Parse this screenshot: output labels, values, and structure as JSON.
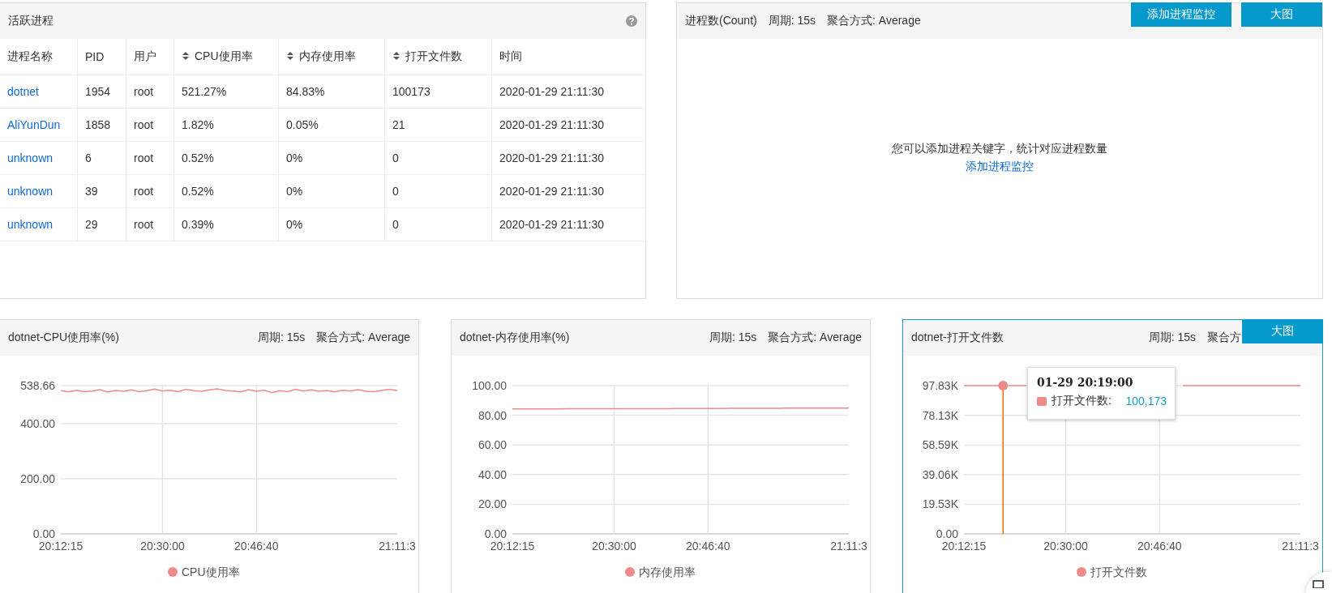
{
  "process_panel": {
    "title": "活跃进程",
    "columns": [
      {
        "label": "进程名称",
        "sortable": false
      },
      {
        "label": "PID",
        "sortable": false
      },
      {
        "label": "用户",
        "sortable": false
      },
      {
        "label": "CPU使用率",
        "sortable": true
      },
      {
        "label": "内存使用率",
        "sortable": true
      },
      {
        "label": "打开文件数",
        "sortable": true
      },
      {
        "label": "时间",
        "sortable": false
      }
    ],
    "rows": [
      [
        "dotnet",
        "1954",
        "root",
        "521.27%",
        "84.83%",
        "100173",
        "2020-01-29 21:11:30"
      ],
      [
        "AliYunDun",
        "1858",
        "root",
        "1.82%",
        "0.05%",
        "21",
        "2020-01-29 21:11:30"
      ],
      [
        "unknown",
        "6",
        "root",
        "0.52%",
        "0%",
        "0",
        "2020-01-29 21:11:30"
      ],
      [
        "unknown",
        "39",
        "root",
        "0.52%",
        "0%",
        "0",
        "2020-01-29 21:11:30"
      ],
      [
        "unknown",
        "29",
        "root",
        "0.39%",
        "0%",
        "0",
        "2020-01-29 21:11:30"
      ]
    ]
  },
  "count_panel": {
    "title": "进程数(Count)",
    "period": "周期: 15s",
    "aggregation": "聚合方式: Average",
    "buttons": [
      "添加进程监控",
      "大图"
    ],
    "empty_message": "您可以添加进程关键字，统计对应进程数量",
    "empty_link": "添加进程监控"
  },
  "chart_panels": [
    {
      "title": "dotnet-CPU使用率(%)",
      "period": "周期: 15s",
      "aggregation": "聚合方式: Average",
      "selected": false,
      "chart_data": {
        "type": "line",
        "grid": true,
        "categories": [
          "20:12:15",
          null,
          null,
          null,
          null,
          null,
          null,
          null,
          null,
          null,
          null,
          null,
          null,
          "20:30:00",
          null,
          null,
          null,
          null,
          null,
          null,
          null,
          null,
          null,
          null,
          null,
          "20:46:40",
          null,
          null,
          null,
          null,
          null,
          null,
          null,
          null,
          null,
          null,
          null,
          null,
          null,
          null,
          null,
          null,
          null,
          "21:11:3"
        ],
        "series": [
          {
            "name": "CPU使用率",
            "color": "#ef8a8a",
            "values": [
              520,
              516,
              522,
              517,
              519,
              524,
              515,
              521,
              518,
              523,
              517,
              520,
              526,
              519,
              522,
              517,
              525,
              520,
              518,
              523,
              527,
              521,
              519,
              516,
              524,
              518,
              522,
              513,
              520,
              517,
              525,
              519,
              523,
              518,
              521,
              516,
              522,
              519,
              524,
              518,
              517,
              521,
              525,
              520
            ]
          }
        ],
        "ylim": [
          0,
          538.66
        ],
        "yticks": [
          {
            "value": 0,
            "label": "0.00"
          },
          {
            "value": 200,
            "label": "200.00"
          },
          {
            "value": 400,
            "label": "400.00"
          },
          {
            "value": 538.66,
            "label": "538.66"
          }
        ]
      }
    },
    {
      "title": "dotnet-内存使用率(%)",
      "period": "周期: 15s",
      "aggregation": "聚合方式: Average",
      "selected": false,
      "chart_data": {
        "type": "line",
        "grid": true,
        "categories": [
          "20:12:15",
          null,
          null,
          null,
          null,
          null,
          null,
          null,
          null,
          null,
          null,
          null,
          null,
          "20:30:00",
          null,
          null,
          null,
          null,
          null,
          null,
          null,
          null,
          null,
          null,
          null,
          "20:46:40",
          null,
          null,
          null,
          null,
          null,
          null,
          null,
          null,
          null,
          null,
          null,
          null,
          null,
          null,
          null,
          null,
          null,
          "21:11:3"
        ],
        "series": [
          {
            "name": "内存使用率",
            "color": "#ef8a8a",
            "values": [
              84.3,
              84.3,
              84.3,
              84.3,
              84.3,
              84.3,
              84.3,
              84.4,
              84.4,
              84.4,
              84.4,
              84.4,
              84.4,
              84.4,
              84.5,
              84.5,
              84.5,
              84.5,
              84.5,
              84.5,
              84.5,
              84.6,
              84.6,
              84.6,
              84.6,
              84.6,
              84.6,
              84.6,
              84.7,
              84.7,
              84.7,
              84.7,
              84.7,
              84.7,
              84.7,
              84.8,
              84.8,
              84.8,
              84.8,
              84.8,
              84.8,
              84.8,
              84.8,
              84.8
            ]
          }
        ],
        "ylim": [
          0,
          100
        ],
        "yticks": [
          {
            "value": 0,
            "label": "0.00"
          },
          {
            "value": 20,
            "label": "20.00"
          },
          {
            "value": 40,
            "label": "40.00"
          },
          {
            "value": 60,
            "label": "60.00"
          },
          {
            "value": 80,
            "label": "80.00"
          },
          {
            "value": 100,
            "label": "100.00"
          }
        ]
      }
    },
    {
      "title": "dotnet-打开文件数",
      "period": "周期: 15s",
      "aggregation": "聚合方",
      "selected": true,
      "button": "大图",
      "tooltip": {
        "title": "01-29 20:19:00",
        "label": "打开文件数:",
        "value": "100,173"
      },
      "chart_data": {
        "type": "line",
        "grid": true,
        "categories": [
          "20:12:15",
          null,
          null,
          null,
          null,
          null,
          null,
          null,
          null,
          null,
          null,
          null,
          null,
          "20:30:00",
          null,
          null,
          null,
          null,
          null,
          null,
          null,
          null,
          null,
          null,
          null,
          "20:46:40",
          null,
          null,
          null,
          null,
          null,
          null,
          null,
          null,
          null,
          null,
          null,
          null,
          null,
          null,
          null,
          null,
          null,
          "21:11:3"
        ],
        "series": [
          {
            "name": "打开文件数",
            "color": "#ef8a8a",
            "values": [
              97800,
              97800,
              97800,
              97800,
              97800,
              97800,
              97800,
              97800,
              97800,
              null,
              null,
              null,
              null,
              null,
              null,
              null,
              null,
              null,
              null,
              null,
              null,
              null,
              null,
              null,
              null,
              null,
              null,
              null,
              97800,
              97800,
              97800,
              97800,
              97800,
              97800,
              97800,
              97800,
              97800,
              97800,
              97800,
              97800,
              97800,
              97800,
              97800,
              97800
            ]
          }
        ],
        "ylim": [
          0,
          97830
        ],
        "yticks": [
          {
            "value": 0,
            "label": "0.00"
          },
          {
            "value": 19530,
            "label": "19.53K"
          },
          {
            "value": 39060,
            "label": "39.06K"
          },
          {
            "value": 58590,
            "label": "58.59K"
          },
          {
            "value": 78130,
            "label": "78.13K"
          },
          {
            "value": 97830,
            "label": "97.83K"
          }
        ]
      }
    }
  ]
}
